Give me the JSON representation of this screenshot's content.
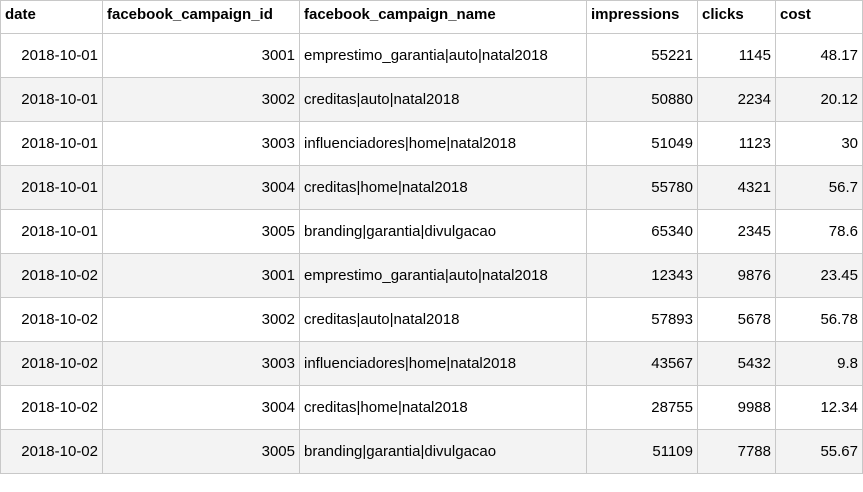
{
  "table": {
    "columns": [
      "date",
      "facebook_campaign_id",
      "facebook_campaign_name",
      "impressions",
      "clicks",
      "cost"
    ],
    "rows": [
      [
        "2018-10-01",
        "3001",
        "emprestimo_garantia|auto|natal2018",
        "55221",
        "1145",
        "48.17"
      ],
      [
        "2018-10-01",
        "3002",
        "creditas|auto|natal2018",
        "50880",
        "2234",
        "20.12"
      ],
      [
        "2018-10-01",
        "3003",
        "influenciadores|home|natal2018",
        "51049",
        "1123",
        "30"
      ],
      [
        "2018-10-01",
        "3004",
        "creditas|home|natal2018",
        "55780",
        "4321",
        "56.7"
      ],
      [
        "2018-10-01",
        "3005",
        "branding|garantia|divulgacao",
        "65340",
        "2345",
        "78.6"
      ],
      [
        "2018-10-02",
        "3001",
        "emprestimo_garantia|auto|natal2018",
        "12343",
        "9876",
        "23.45"
      ],
      [
        "2018-10-02",
        "3002",
        "creditas|auto|natal2018",
        "57893",
        "5678",
        "56.78"
      ],
      [
        "2018-10-02",
        "3003",
        "influenciadores|home|natal2018",
        "43567",
        "5432",
        "9.8"
      ],
      [
        "2018-10-02",
        "3004",
        "creditas|home|natal2018",
        "28755",
        "9988",
        "12.34"
      ],
      [
        "2018-10-02",
        "3005",
        "branding|garantia|divulgacao",
        "51109",
        "7788",
        "55.67"
      ]
    ]
  }
}
